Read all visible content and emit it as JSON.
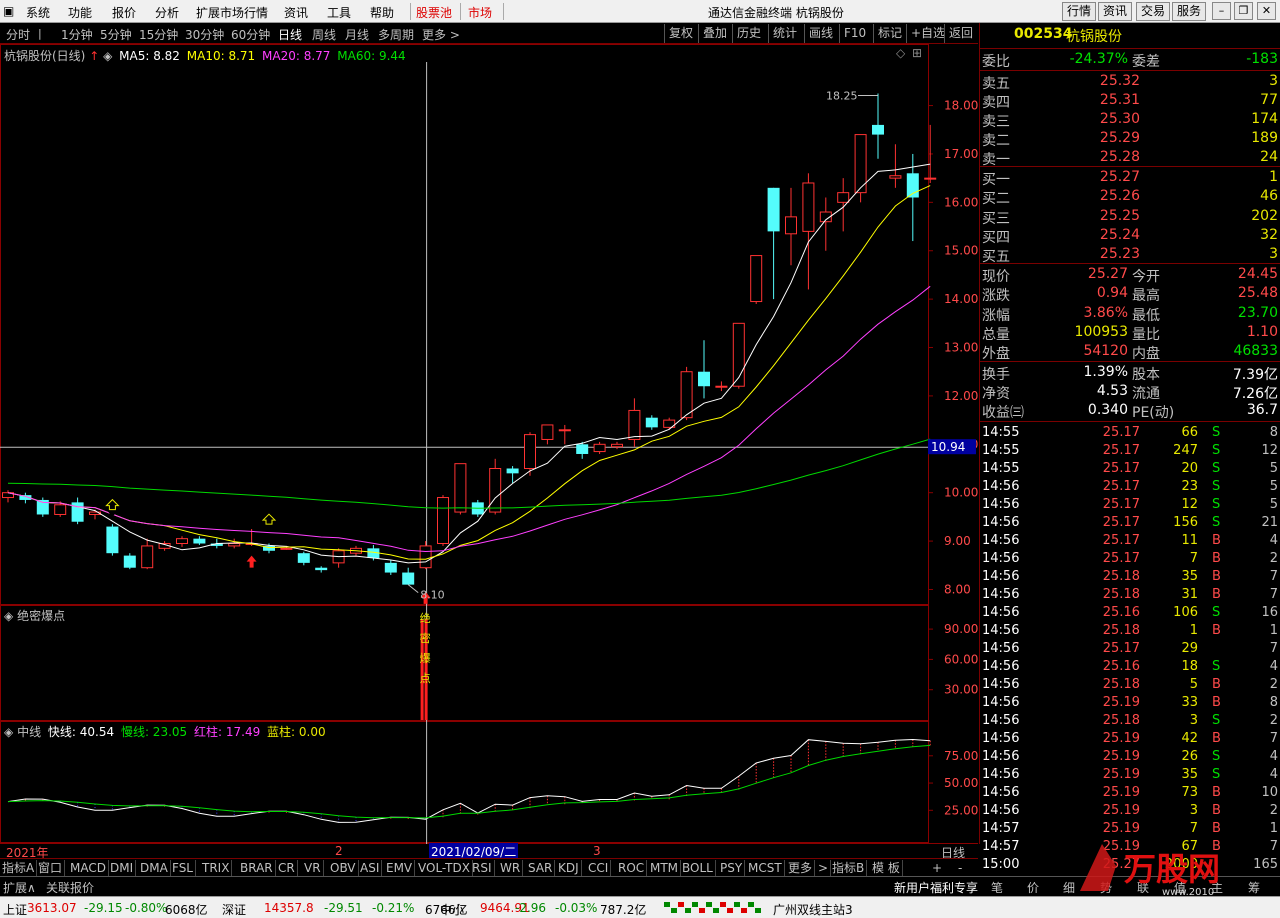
{
  "menu": {
    "items": [
      "系统",
      "功能",
      "报价",
      "分析",
      "扩展市场行情",
      "资讯",
      "工具",
      "帮助"
    ],
    "highlight": [
      "股票池",
      "市场"
    ],
    "title": "通达信金融终端  杭锅股份",
    "right_buttons": [
      "行情",
      "资讯",
      "交易",
      "服务"
    ]
  },
  "period": {
    "items": [
      "分时",
      "1分钟",
      "5分钟",
      "15分钟",
      "30分钟",
      "60分钟",
      "日线",
      "周线",
      "月线",
      "多周期",
      "更多 >"
    ],
    "active": "日线",
    "tools": [
      "复权",
      "叠加",
      "历史",
      "统计",
      "画线",
      "F10",
      "标记",
      "+自选",
      "返回"
    ]
  },
  "chart": {
    "title": "杭锅股份(日线)",
    "ma_labels": [
      {
        "text": "MA5: 8.82",
        "color": "#ffffff"
      },
      {
        "text": "MA10: 8.71",
        "color": "#ffff00"
      },
      {
        "text": "MA20: 8.77",
        "color": "#ff40ff"
      },
      {
        "text": "MA60: 9.44",
        "color": "#00e000"
      }
    ],
    "y_ticks": [
      "18.00",
      "17.00",
      "16.00",
      "15.00",
      "14.00",
      "13.00",
      "12.00",
      "11.00",
      "10.00",
      "9.00",
      "8.00"
    ],
    "y_values": [
      18,
      17,
      16,
      15,
      14,
      13,
      12,
      11,
      10,
      9,
      8
    ],
    "high_label": "18.25",
    "low_label": "8.10",
    "crosshair_value": "10.94",
    "crosshair_price": 10.94,
    "x_labels": [
      "2021年",
      "2",
      "2021/02/09/二",
      "3"
    ],
    "x_label_bottom": "日线"
  },
  "ind1": {
    "title": "绝密爆点",
    "y_ticks": [
      "90.00",
      "60.00",
      "30.00"
    ],
    "y_values": [
      90,
      60,
      30
    ],
    "bar_chars": [
      "绝",
      "密",
      "爆",
      "点"
    ]
  },
  "ind2": {
    "title": "中线",
    "labels": [
      {
        "text": "快线: 40.54",
        "color": "#ffffff"
      },
      {
        "text": "慢线: 23.05",
        "color": "#00e000"
      },
      {
        "text": "红柱: 17.49",
        "color": "#ff40ff"
      },
      {
        "text": "蓝柱: 0.00",
        "color": "#e8e800"
      }
    ],
    "y_ticks": [
      "75.00",
      "50.00",
      "25.00"
    ],
    "y_values": [
      75,
      50,
      25
    ]
  },
  "stock": {
    "code": "002534",
    "name": "杭锅股份",
    "wb_label": "委比",
    "wb": "-24.37%",
    "wc_label": "委差",
    "wc": "-183",
    "sell": [
      {
        "label": "卖五",
        "price": "25.32",
        "vol": "3"
      },
      {
        "label": "卖四",
        "price": "25.31",
        "vol": "77"
      },
      {
        "label": "卖三",
        "price": "25.30",
        "vol": "174"
      },
      {
        "label": "卖二",
        "price": "25.29",
        "vol": "189"
      },
      {
        "label": "卖一",
        "price": "25.28",
        "vol": "24"
      }
    ],
    "buy": [
      {
        "label": "买一",
        "price": "25.27",
        "vol": "1"
      },
      {
        "label": "买二",
        "price": "25.26",
        "vol": "46"
      },
      {
        "label": "买三",
        "price": "25.25",
        "vol": "202"
      },
      {
        "label": "买四",
        "price": "25.24",
        "vol": "32"
      },
      {
        "label": "买五",
        "price": "25.23",
        "vol": "3"
      }
    ],
    "quote": [
      {
        "l1": "现价",
        "v1": "25.27",
        "c1": "red",
        "l2": "今开",
        "v2": "24.45",
        "c2": "red"
      },
      {
        "l1": "涨跌",
        "v1": "0.94",
        "c1": "red",
        "l2": "最高",
        "v2": "25.48",
        "c2": "red"
      },
      {
        "l1": "涨幅",
        "v1": "3.86%",
        "c1": "red",
        "l2": "最低",
        "v2": "23.70",
        "c2": "grn"
      },
      {
        "l1": "总量",
        "v1": "100953",
        "c1": "yel",
        "l2": "量比",
        "v2": "1.10",
        "c2": "red"
      },
      {
        "l1": "外盘",
        "v1": "54120",
        "c1": "red",
        "l2": "内盘",
        "v2": "46833",
        "c2": "grn"
      }
    ],
    "fund": [
      {
        "l1": "换手",
        "v1": "1.39%",
        "l2": "股本",
        "v2": "7.39亿"
      },
      {
        "l1": "净资",
        "v1": "4.53",
        "l2": "流通",
        "v2": "7.26亿"
      },
      {
        "l1": "收益㈢",
        "v1": "0.340",
        "l2": "PE(动)",
        "v2": "36.7"
      }
    ]
  },
  "ticks": [
    [
      "14:55",
      "25.17",
      "66",
      "S",
      "8"
    ],
    [
      "14:55",
      "25.17",
      "247",
      "S",
      "12"
    ],
    [
      "14:55",
      "25.17",
      "20",
      "S",
      "5"
    ],
    [
      "14:56",
      "25.17",
      "23",
      "S",
      "5"
    ],
    [
      "14:56",
      "25.17",
      "12",
      "S",
      "5"
    ],
    [
      "14:56",
      "25.17",
      "156",
      "S",
      "21"
    ],
    [
      "14:56",
      "25.17",
      "11",
      "B",
      "4"
    ],
    [
      "14:56",
      "25.17",
      "7",
      "B",
      "2"
    ],
    [
      "14:56",
      "25.18",
      "35",
      "B",
      "7"
    ],
    [
      "14:56",
      "25.18",
      "31",
      "B",
      "7"
    ],
    [
      "14:56",
      "25.16",
      "106",
      "S",
      "16"
    ],
    [
      "14:56",
      "25.18",
      "1",
      "B",
      "1"
    ],
    [
      "14:56",
      "25.17",
      "29",
      "",
      "7"
    ],
    [
      "14:56",
      "25.16",
      "18",
      "S",
      "4"
    ],
    [
      "14:56",
      "25.18",
      "5",
      "B",
      "2"
    ],
    [
      "14:56",
      "25.19",
      "33",
      "B",
      "8"
    ],
    [
      "14:56",
      "25.18",
      "3",
      "S",
      "2"
    ],
    [
      "14:56",
      "25.19",
      "42",
      "B",
      "7"
    ],
    [
      "14:56",
      "25.19",
      "26",
      "S",
      "4"
    ],
    [
      "14:56",
      "25.19",
      "35",
      "S",
      "4"
    ],
    [
      "14:56",
      "25.19",
      "73",
      "B",
      "10"
    ],
    [
      "14:56",
      "25.19",
      "3",
      "B",
      "2"
    ],
    [
      "14:57",
      "25.19",
      "7",
      "B",
      "1"
    ],
    [
      "14:57",
      "25.19",
      "67",
      "B",
      "7"
    ],
    [
      "15:00",
      "25.27",
      "2000",
      "",
      "165"
    ]
  ],
  "indicator_tabs": [
    "指标A",
    "窗口",
    "MACD",
    "DMI",
    "DMA",
    "FSL",
    "TRIX",
    "BRAR",
    "CR",
    "VR",
    "OBV",
    "ASI",
    "EMV",
    "VOL-TDX",
    "RSI",
    "WR",
    "SAR",
    "KDJ",
    "CCI",
    "ROC",
    "MTM",
    "BOLL",
    "PSY",
    "MCST",
    "更多",
    ">",
    "指标B",
    "模 板"
  ],
  "ind_right": [
    "+",
    "-"
  ],
  "tabbar": {
    "left": [
      "扩展∧",
      "关联报价"
    ],
    "mid": "新用户福利专享",
    "right": [
      "笔",
      "价",
      "细",
      "势",
      "联",
      "值",
      "主",
      "筹"
    ]
  },
  "status": {
    "items": [
      {
        "t": "上证",
        "c": ""
      },
      {
        "t": "3613.07",
        "c": "sred"
      },
      {
        "t": "-29.15",
        "c": "sgrn"
      },
      {
        "t": "-0.80%",
        "c": "sgrn"
      },
      {
        "t": "6068亿",
        "c": ""
      },
      {
        "t": "深证",
        "c": ""
      },
      {
        "t": "14357.8",
        "c": "sred"
      },
      {
        "t": "-29.51",
        "c": "sgrn"
      },
      {
        "t": "-0.21%",
        "c": "sgrn"
      },
      {
        "t": "6766亿",
        "c": ""
      },
      {
        "t": "中小",
        "c": ""
      },
      {
        "t": "9464.91",
        "c": "sred"
      },
      {
        "t": "-2.96",
        "c": "sgrn"
      },
      {
        "t": "-0.03%",
        "c": "sgrn"
      },
      {
        "t": "787.2亿",
        "c": ""
      },
      {
        "t": "广州双线主站3",
        "c": ""
      }
    ]
  },
  "watermark": {
    "text": "万股网",
    "url": "www.2010"
  },
  "candles": [
    [
      9.9,
      10.0,
      9.8,
      10.05
    ],
    [
      9.95,
      9.85,
      9.78,
      10.0
    ],
    [
      9.85,
      9.55,
      9.5,
      9.9
    ],
    [
      9.55,
      9.75,
      9.5,
      9.82
    ],
    [
      9.8,
      9.4,
      9.35,
      9.9
    ],
    [
      9.55,
      9.6,
      9.45,
      9.65
    ],
    [
      9.3,
      8.75,
      8.7,
      9.35
    ],
    [
      8.7,
      8.45,
      8.42,
      8.75
    ],
    [
      8.45,
      8.9,
      8.42,
      9.05
    ],
    [
      8.85,
      8.95,
      8.8,
      9.0
    ],
    [
      8.95,
      9.05,
      8.88,
      9.1
    ],
    [
      9.05,
      8.95,
      8.92,
      9.1
    ],
    [
      8.95,
      8.9,
      8.85,
      9.05
    ],
    [
      8.9,
      8.95,
      8.85,
      9.05
    ],
    [
      8.95,
      8.95,
      8.9,
      9.25
    ],
    [
      8.9,
      8.8,
      8.75,
      8.95
    ],
    [
      8.85,
      8.85,
      8.82,
      8.9
    ],
    [
      8.75,
      8.55,
      8.5,
      8.78
    ],
    [
      8.45,
      8.4,
      8.35,
      8.48
    ],
    [
      8.55,
      8.8,
      8.45,
      8.85
    ],
    [
      8.75,
      8.85,
      8.7,
      8.9
    ],
    [
      8.85,
      8.65,
      8.6,
      8.92
    ],
    [
      8.55,
      8.35,
      8.3,
      8.6
    ],
    [
      8.35,
      8.1,
      8.1,
      8.45
    ],
    [
      8.45,
      8.9,
      8.42,
      9.0
    ],
    [
      8.95,
      9.9,
      8.9,
      9.95
    ],
    [
      9.6,
      10.6,
      9.55,
      10.6
    ],
    [
      9.8,
      9.55,
      9.5,
      9.85
    ],
    [
      9.6,
      10.5,
      9.55,
      10.7
    ],
    [
      10.5,
      10.4,
      10.2,
      10.55
    ],
    [
      10.5,
      11.2,
      10.35,
      11.25
    ],
    [
      11.1,
      11.4,
      11.0,
      11.4
    ],
    [
      11.3,
      11.3,
      11.0,
      11.4
    ],
    [
      11.0,
      10.8,
      10.7,
      11.05
    ],
    [
      10.85,
      11.0,
      10.8,
      11.05
    ],
    [
      10.95,
      11.0,
      10.9,
      11.05
    ],
    [
      11.1,
      11.7,
      10.95,
      11.95
    ],
    [
      11.55,
      11.35,
      11.3,
      11.6
    ],
    [
      11.35,
      11.5,
      11.3,
      11.55
    ],
    [
      11.55,
      12.5,
      11.5,
      12.6
    ],
    [
      12.5,
      12.2,
      11.95,
      13.15
    ],
    [
      12.2,
      12.2,
      12.1,
      12.3
    ],
    [
      12.2,
      13.5,
      12.15,
      13.5
    ],
    [
      13.95,
      14.9,
      13.9,
      14.9
    ],
    [
      16.3,
      15.4,
      14.0,
      16.3
    ],
    [
      15.35,
      15.7,
      14.7,
      16.3
    ],
    [
      15.4,
      16.4,
      14.2,
      16.6
    ],
    [
      15.6,
      15.8,
      15.0,
      16.1
    ],
    [
      16.0,
      16.2,
      15.4,
      16.5
    ],
    [
      16.2,
      17.4,
      16.0,
      17.4
    ],
    [
      17.6,
      17.4,
      16.9,
      18.25
    ],
    [
      16.5,
      16.55,
      16.3,
      17.2
    ],
    [
      16.6,
      16.1,
      15.2,
      17.0
    ],
    [
      16.5,
      16.5,
      16.4,
      17.6
    ]
  ]
}
